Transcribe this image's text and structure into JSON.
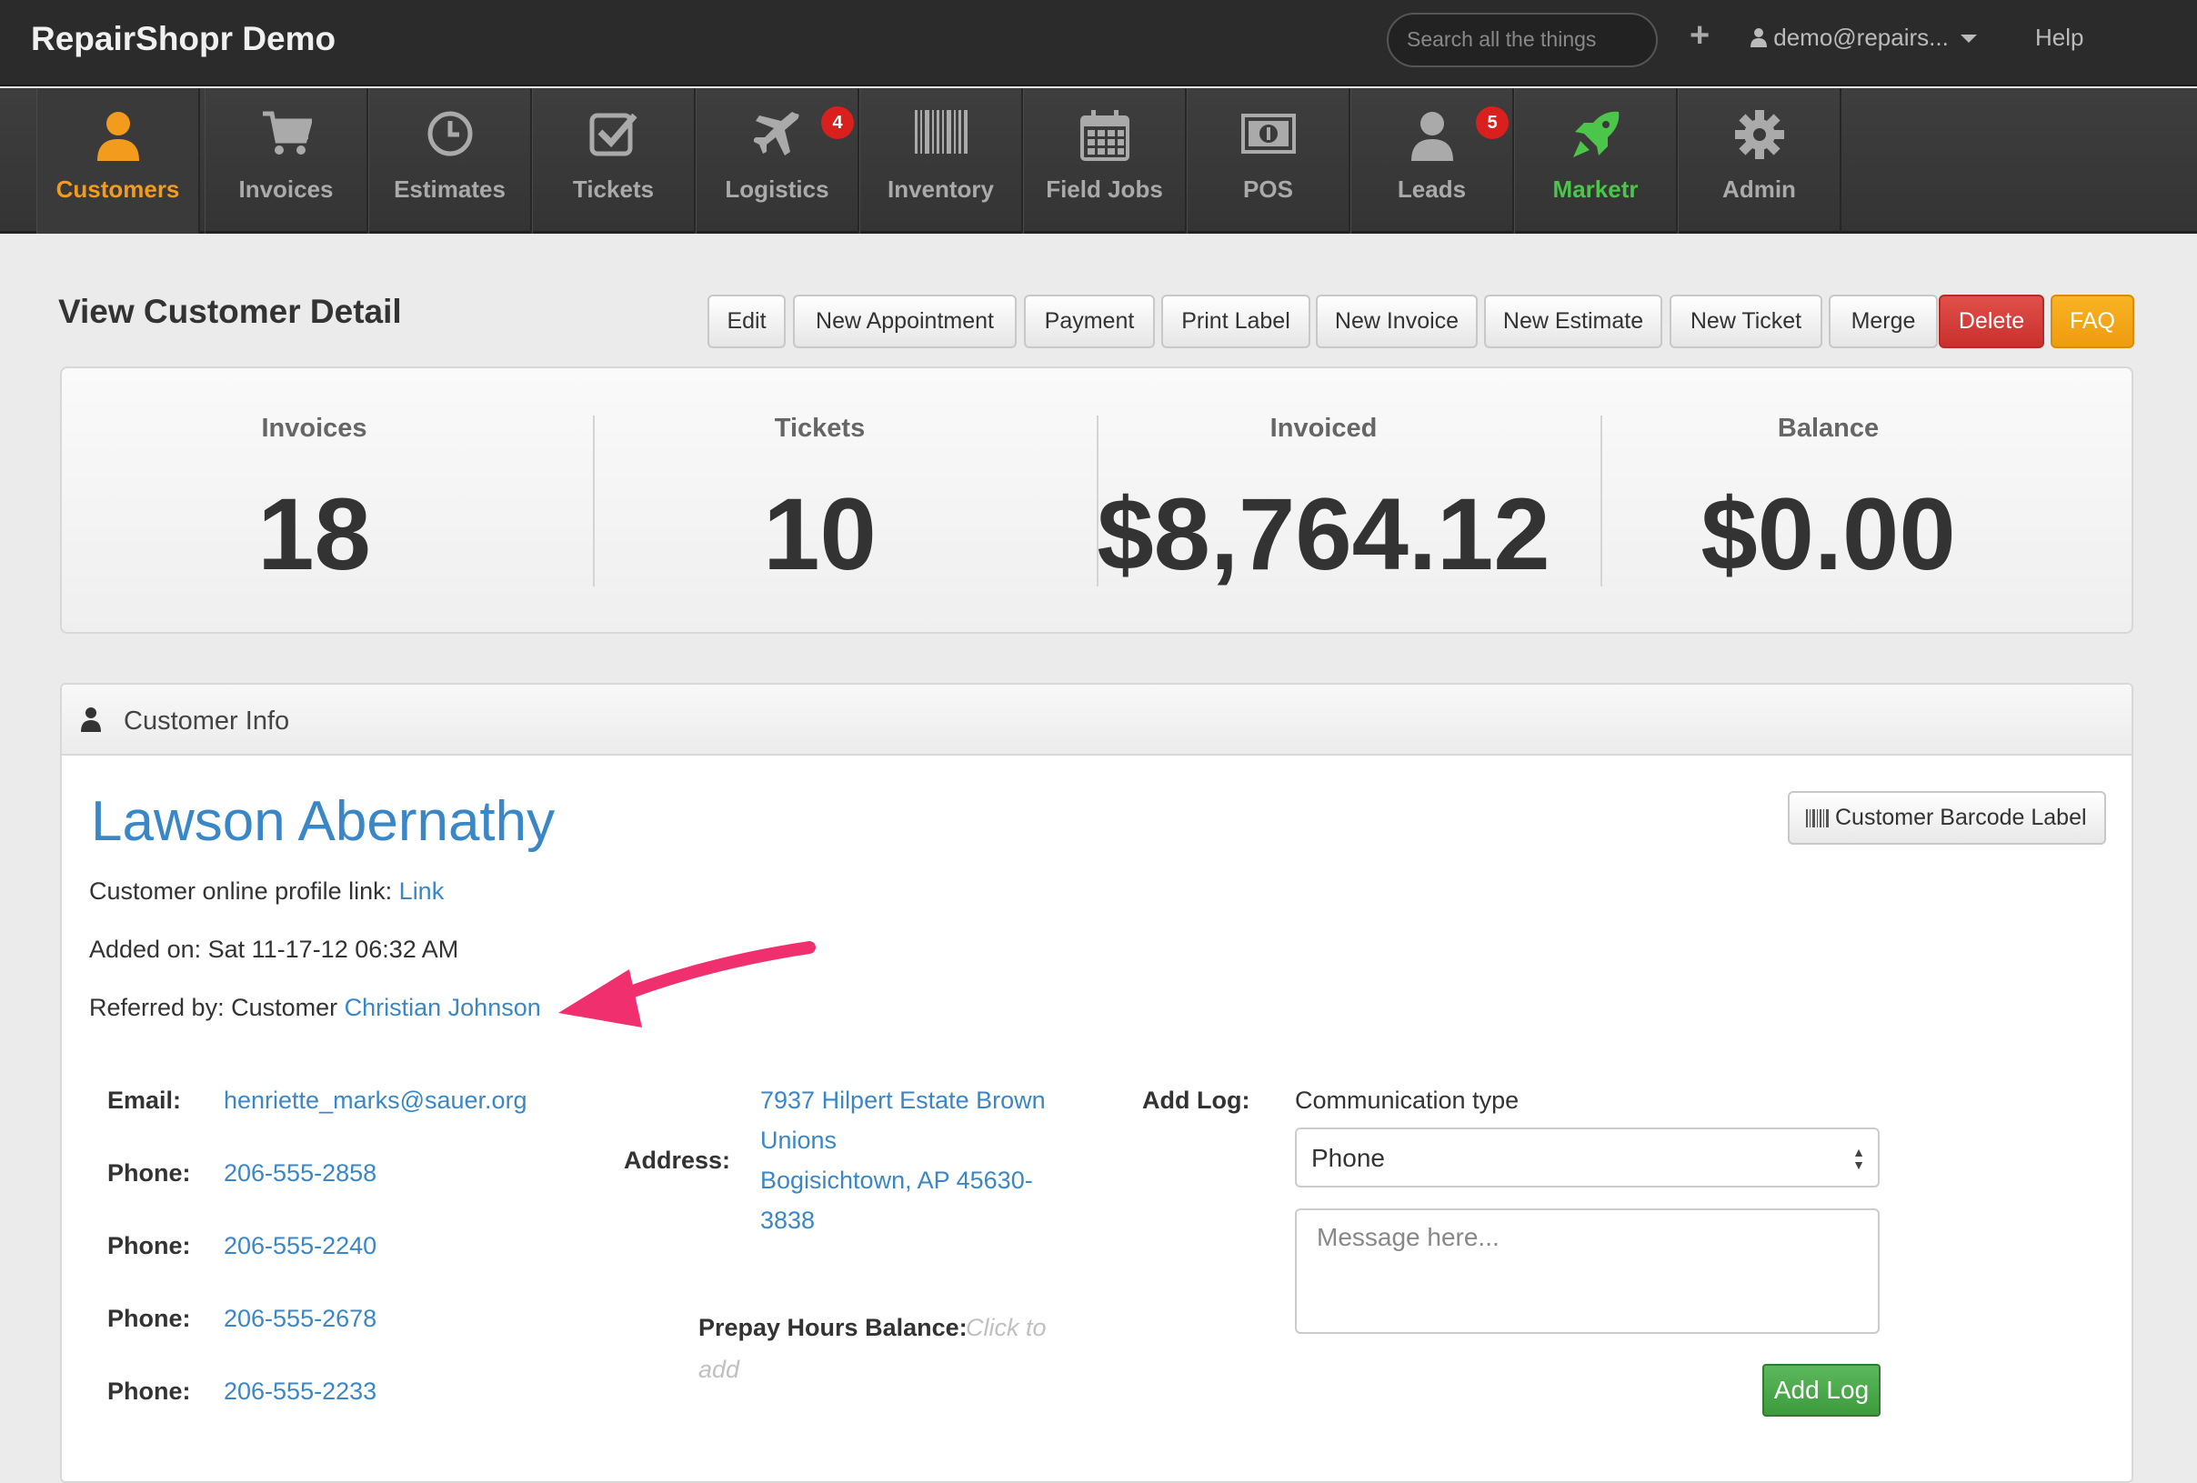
{
  "app": {
    "brand": "RepairShopr Demo",
    "search_placeholder": "Search all the things",
    "plus": "+",
    "user": "demo@repairs...",
    "help": "Help"
  },
  "nav": {
    "items": [
      {
        "label": "Customers",
        "icon": "person-icon"
      },
      {
        "label": "Invoices",
        "icon": "cart-icon"
      },
      {
        "label": "Estimates",
        "icon": "clock-icon"
      },
      {
        "label": "Tickets",
        "icon": "checkbox-icon"
      },
      {
        "label": "Logistics",
        "icon": "plane-icon",
        "badge": "4"
      },
      {
        "label": "Inventory",
        "icon": "barcode-icon"
      },
      {
        "label": "Field Jobs",
        "icon": "calendar-icon"
      },
      {
        "label": "POS",
        "icon": "money-icon"
      },
      {
        "label": "Leads",
        "icon": "person-icon",
        "badge": "5"
      },
      {
        "label": "Marketr",
        "icon": "rocket-icon"
      },
      {
        "label": "Admin",
        "icon": "gear-icon"
      }
    ]
  },
  "page": {
    "title": "View Customer Detail",
    "actions": [
      "Edit",
      "New Appointment",
      "Payment",
      "Print Label",
      "New Invoice",
      "New Estimate",
      "New Ticket",
      "Merge",
      "Delete",
      "FAQ"
    ]
  },
  "stats": [
    {
      "label": "Invoices",
      "value": "18"
    },
    {
      "label": "Tickets",
      "value": "10"
    },
    {
      "label": "Invoiced",
      "value": "$8,764.12"
    },
    {
      "label": "Balance",
      "value": "$0.00"
    }
  ],
  "customer": {
    "panel_title": "Customer Info",
    "name": "Lawson Abernathy",
    "barcode_button": "Customer Barcode Label",
    "profile_label": "Customer online profile link:",
    "profile_link": "Link",
    "added_on": "Added on: Sat 11-17-12 06:32 AM",
    "referred_label": "Referred by: Customer",
    "referred_name": "Christian Johnson",
    "email_label": "Email:",
    "email": "henriette_marks@sauer.org",
    "phone_label": "Phone:",
    "phones": [
      "206-555-2858",
      "206-555-2240",
      "206-555-2678",
      "206-555-2233"
    ],
    "address_label": "Address:",
    "address_lines": [
      "7937 Hilpert Estate Brown",
      "Unions",
      "Bogisichtown, AP 45630-",
      "3838"
    ],
    "prepay_label": "Prepay Hours Balance:",
    "prepay_value_1": "Click to",
    "prepay_value_2": "add",
    "add_log_label": "Add Log:",
    "comm_type_label": "Communication type",
    "comm_type_value": "Phone",
    "message_placeholder": "Message here...",
    "add_log_button": "Add Log"
  },
  "colors": {
    "accent_orange": "#f29b1d",
    "marketr_green": "#4bc54a",
    "link_blue": "#3a87c8",
    "delete_red": "#d9534f",
    "faq_orange": "#f0a30a",
    "annotation_pink": "#f0306e"
  }
}
